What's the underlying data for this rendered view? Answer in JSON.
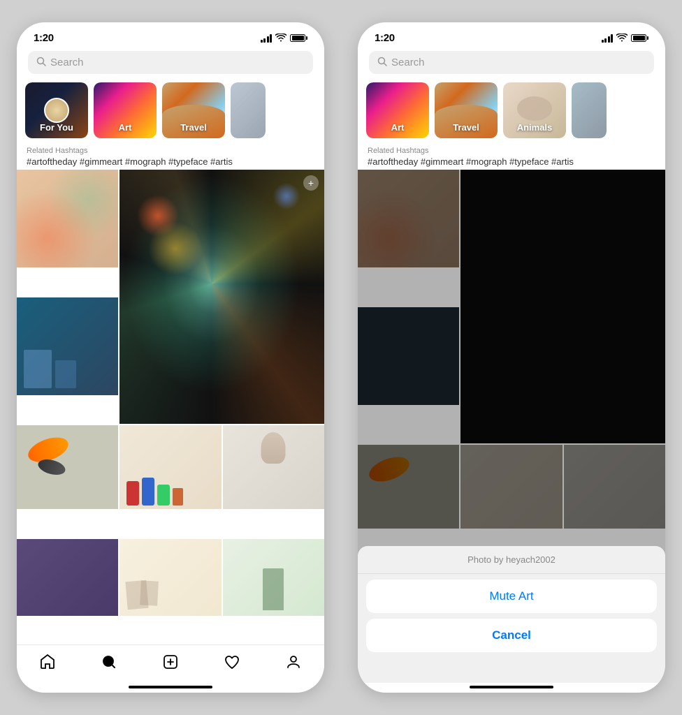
{
  "phones": [
    {
      "id": "phone-left",
      "statusBar": {
        "time": "1:20",
        "hasArrow": true
      },
      "searchBar": {
        "placeholder": "Search"
      },
      "categoryTabs": [
        {
          "id": "for-you",
          "label": "For You",
          "type": "for-you"
        },
        {
          "id": "art",
          "label": "Art",
          "type": "art"
        },
        {
          "id": "travel",
          "label": "Travel",
          "type": "travel"
        }
      ],
      "hashtagsLabel": "Related Hashtags",
      "hashtags": "#artoftheday #gimmeart #mograph #typeface #artis",
      "modal": null
    },
    {
      "id": "phone-right",
      "statusBar": {
        "time": "1:20",
        "hasArrow": true
      },
      "searchBar": {
        "placeholder": "Search"
      },
      "categoryTabs": [
        {
          "id": "art",
          "label": "Art",
          "type": "art"
        },
        {
          "id": "travel",
          "label": "Travel",
          "type": "travel"
        },
        {
          "id": "animals",
          "label": "Animals",
          "type": "animals"
        }
      ],
      "hashtagsLabel": "Related Hashtags",
      "hashtags": "#artoftheday #gimmeart #mograph #typeface #artis",
      "modal": {
        "attribution": "Photo by heyach2002",
        "muteLabel": "Mute Art",
        "cancelLabel": "Cancel"
      }
    }
  ],
  "bottomNav": {
    "items": [
      "home",
      "search",
      "create",
      "heart",
      "profile"
    ]
  }
}
